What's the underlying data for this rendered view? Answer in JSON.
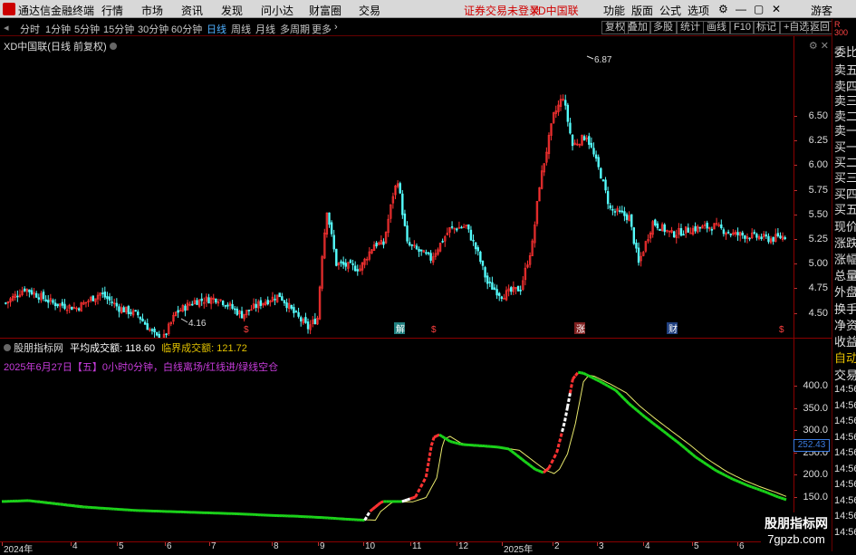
{
  "menu": {
    "app_name": "通达信金融终端",
    "items": [
      "行情",
      "市场",
      "资讯",
      "发现",
      "问小达",
      "财富圈",
      "交易"
    ],
    "login_status": "证券交易未登录",
    "stock_name": "XD中国联",
    "right_items": [
      "功能",
      "版面",
      "公式",
      "选项"
    ],
    "guest": "游客"
  },
  "periods": {
    "items": [
      "分时",
      "1分钟",
      "5分钟",
      "15分钟",
      "30分钟",
      "60分钟",
      "日线",
      "周线",
      "月线",
      "多周期",
      "更多"
    ],
    "active": "日线",
    "buttons": [
      "复权",
      "叠加",
      "多股",
      "统计",
      "画线",
      "F10",
      "标记",
      "+自选",
      "返回"
    ]
  },
  "main_chart": {
    "title": "XD中国联(日线 前复权)",
    "high_label": "6.87",
    "low_label": "4.16",
    "y_ticks": [
      "6.50",
      "6.25",
      "6.00",
      "5.75",
      "5.50",
      "5.25",
      "5.00",
      "4.75",
      "4.50"
    ],
    "event_markers": [
      "$",
      "解",
      "$",
      "涨",
      "财",
      "$"
    ]
  },
  "indicator": {
    "name": "股朋指标网",
    "avg_label": "平均成交额:",
    "avg_value": "118.60",
    "critical_label": "临界成交额:",
    "critical_value": "121.72",
    "subtitle": "2025年6月27日【五】0小时0分钟，白线离场/红线进/绿线空仓",
    "y_ticks": [
      "400.0",
      "350.0",
      "300.0",
      "250.0",
      "200.0",
      "150.0"
    ],
    "current_value": "252.43"
  },
  "x_axis": {
    "labels": [
      "2024年",
      "4",
      "5",
      "6",
      "7",
      "8",
      "9",
      "10",
      "11",
      "12",
      "2025年",
      "2",
      "3",
      "4",
      "5",
      "6"
    ]
  },
  "right_panel": {
    "badge_top": "R",
    "badge_num": "300",
    "items": [
      "委比",
      "卖五",
      "卖四",
      "卖三",
      "卖二",
      "卖一",
      "买一",
      "买二",
      "买三",
      "买四",
      "买五",
      "现价",
      "涨跌",
      "涨幅",
      "总量",
      "外盘",
      "换手",
      "净资",
      "收益",
      "自动",
      "交易"
    ],
    "time_items": [
      "14:56",
      "14:56",
      "14:56",
      "14:56",
      "14:56",
      "14:56",
      "14:56",
      "14:56",
      "14:56",
      "14:56"
    ]
  },
  "watermark": {
    "line1": "股朋指标网",
    "line2": "7gpzb.com"
  },
  "colors": {
    "up": "#ff3232",
    "down": "#54fcfc",
    "line_green": "#19d219",
    "line_white": "#ffffff",
    "line_yellow": "#e8e86c"
  }
}
